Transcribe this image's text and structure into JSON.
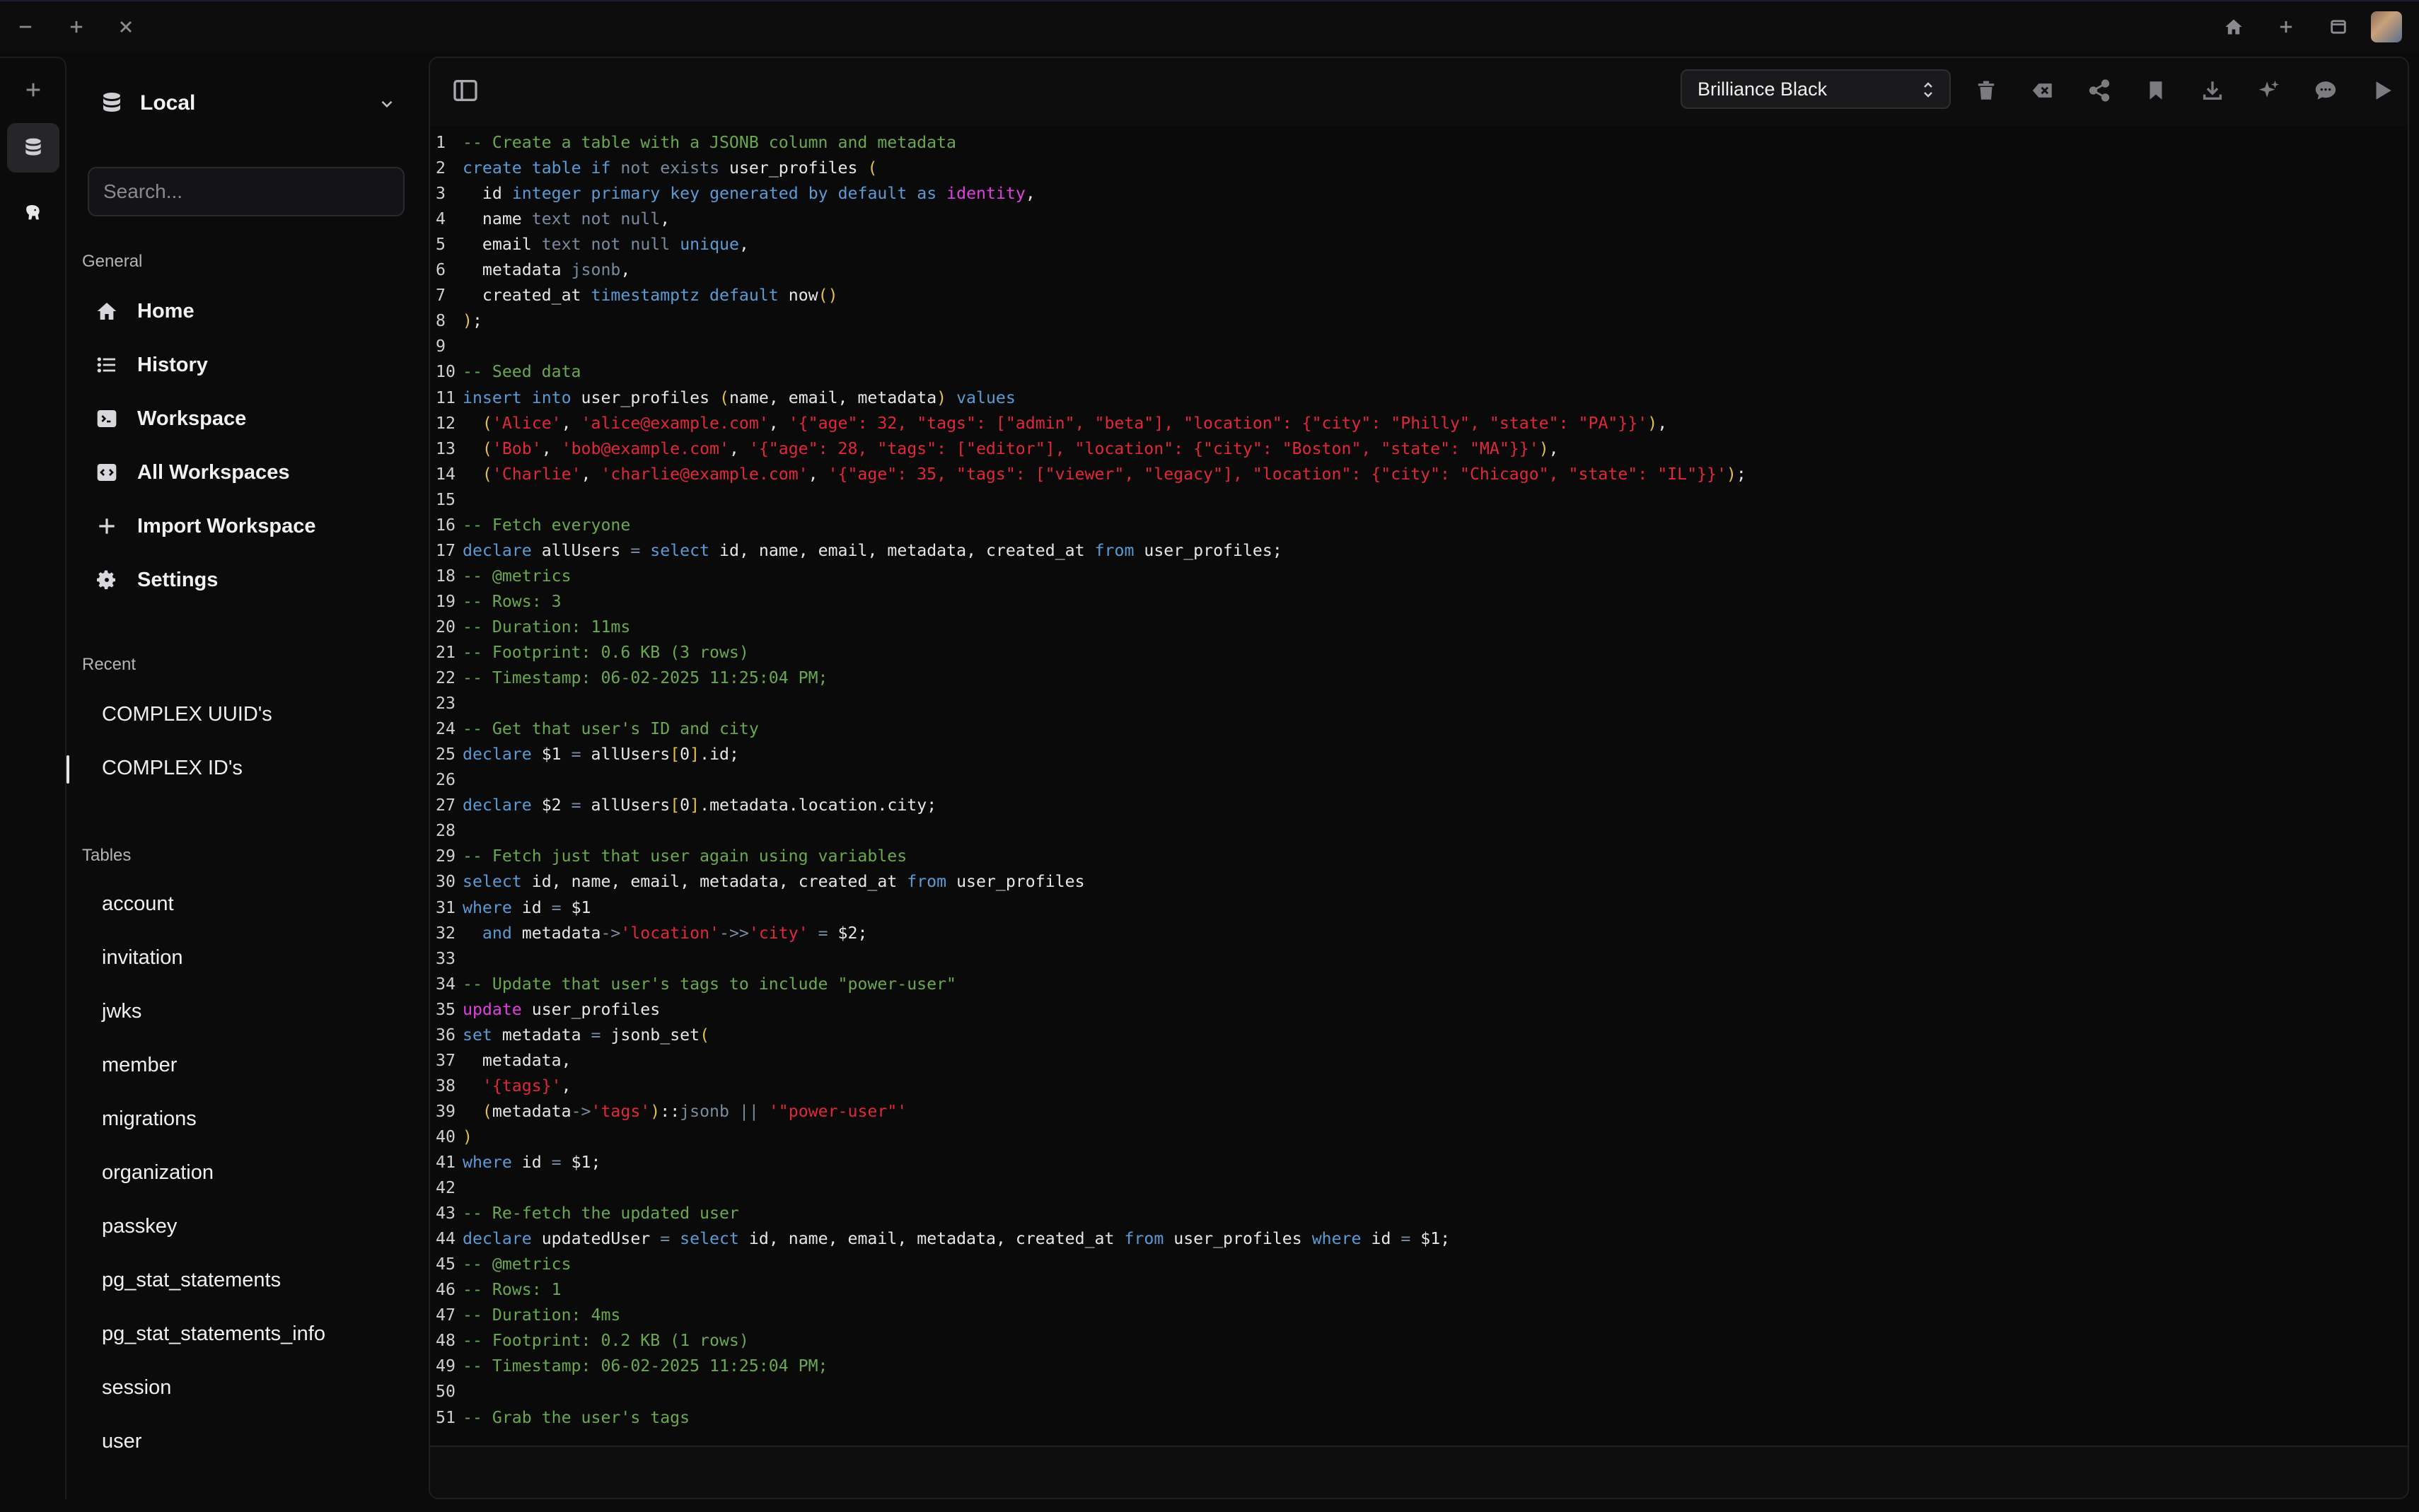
{
  "titlebar": {
    "left_icons": [
      "minimize-icon",
      "plus-icon",
      "close-icon"
    ],
    "right_icons": [
      "home-icon",
      "plus-icon",
      "window-icon",
      "avatar"
    ]
  },
  "sidebar": {
    "connection": "Local",
    "search_placeholder": "Search...",
    "general_heading": "General",
    "general_items": [
      {
        "label": "Home",
        "icon": "home-icon"
      },
      {
        "label": "History",
        "icon": "list-icon"
      },
      {
        "label": "Workspace",
        "icon": "terminal-icon"
      },
      {
        "label": "All Workspaces",
        "icon": "code-icon"
      },
      {
        "label": "Import Workspace",
        "icon": "plus-icon"
      },
      {
        "label": "Settings",
        "icon": "gear-icon"
      }
    ],
    "recent_heading": "Recent",
    "recent_items": [
      "COMPLEX UUID's",
      "COMPLEX ID's"
    ],
    "tables_heading": "Tables",
    "tables": [
      "account",
      "invitation",
      "jwks",
      "member",
      "migrations",
      "organization",
      "passkey",
      "pg_stat_statements",
      "pg_stat_statements_info",
      "session",
      "user"
    ]
  },
  "toolbar": {
    "theme": "Brilliance Black",
    "tools": [
      "trash-icon",
      "clear-icon",
      "share-icon",
      "bookmark-icon",
      "download-icon",
      "sparkle-icon",
      "comment-icon",
      "run-icon"
    ]
  },
  "editor": {
    "lines": [
      "-- Create a table with a JSONB column and metadata",
      "create table if not exists user_profiles (",
      "  id integer primary key generated by default as identity,",
      "  name text not null,",
      "  email text not null unique,",
      "  metadata jsonb,",
      "  created_at timestamptz default now()",
      ");",
      "",
      "-- Seed data",
      "insert into user_profiles (name, email, metadata) values",
      "  ('Alice', 'alice@example.com', '{\"age\": 32, \"tags\": [\"admin\", \"beta\"], \"location\": {\"city\": \"Philly\", \"state\": \"PA\"}}'),",
      "  ('Bob', 'bob@example.com', '{\"age\": 28, \"tags\": [\"editor\"], \"location\": {\"city\": \"Boston\", \"state\": \"MA\"}}'),",
      "  ('Charlie', 'charlie@example.com', '{\"age\": 35, \"tags\": [\"viewer\", \"legacy\"], \"location\": {\"city\": \"Chicago\", \"state\": \"IL\"}}');",
      "",
      "-- Fetch everyone",
      "declare allUsers = select id, name, email, metadata, created_at from user_profiles;",
      "-- @metrics",
      "-- Rows: 3",
      "-- Duration: 11ms",
      "-- Footprint: 0.6 KB (3 rows)",
      "-- Timestamp: 06-02-2025 11:25:04 PM;",
      "",
      "-- Get that user's ID and city",
      "declare $1 = allUsers[0].id;",
      "",
      "declare $2 = allUsers[0].metadata.location.city;",
      "",
      "-- Fetch just that user again using variables",
      "select id, name, email, metadata, created_at from user_profiles",
      "where id = $1",
      "  and metadata->'location'->>'city' = $2;",
      "",
      "-- Update that user's tags to include \"power-user\"",
      "update user_profiles",
      "set metadata = jsonb_set(",
      "  metadata,",
      "  '{tags}',",
      "  (metadata->'tags')::jsonb || '\"power-user\"'",
      ")",
      "where id = $1;",
      "",
      "-- Re-fetch the updated user",
      "declare updatedUser = select id, name, email, metadata, created_at from user_profiles where id = $1;",
      "-- @metrics",
      "-- Rows: 1",
      "-- Duration: 4ms",
      "-- Footprint: 0.2 KB (1 rows)",
      "-- Timestamp: 06-02-2025 11:25:04 PM;",
      "",
      "-- Grab the user's tags"
    ]
  },
  "colors": {
    "comment": "#6aa84f",
    "keyword": "#5b9bd5",
    "dim_keyword": "#7a8aa0",
    "string": "#e0283a",
    "magenta": "#e040e0",
    "bracket": "#e3c04a"
  }
}
